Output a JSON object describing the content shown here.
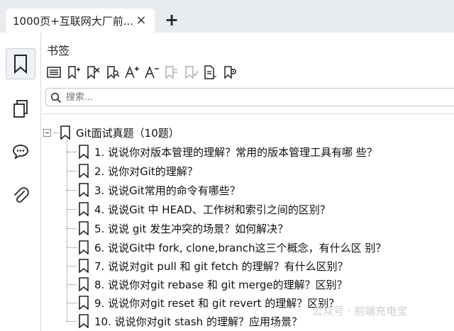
{
  "tab": {
    "title": "1000页+互联网大厂前...",
    "close": "×",
    "new": "+"
  },
  "rail": {
    "items": [
      "bookmarks",
      "pages",
      "comments",
      "attachments"
    ]
  },
  "panel": {
    "title": "书签"
  },
  "search": {
    "placeholder": "搜索..."
  },
  "tree": {
    "root": "Git面试真题（10题）",
    "items": [
      "1. 说说你对版本管理的理解？常用的版本管理工具有哪 些？",
      "2. 说你对Git的理解？",
      "3. 说说Git常用的命令有哪些？",
      "4. 说说Git 中 HEAD、工作树和索引之间的区别？",
      "5. 说说 git 发生冲突的场景？如何解决？",
      "6. 说说Git中 fork, clone,branch这三个概念，有什么区 别？",
      "7. 说说对git pull 和 git fetch 的理解？有什么区别？",
      "8. 说说你对git rebase 和 git merge的理解？区别？",
      "9. 说说你对git reset 和 git revert 的理解？区别？",
      "10. 说说你对git stash 的理解？应用场景？"
    ]
  },
  "watermark": "公众号 · 前端充电宝",
  "colors": {
    "tabbar": "#e8ebf0",
    "accent": "#1a1a1a"
  }
}
